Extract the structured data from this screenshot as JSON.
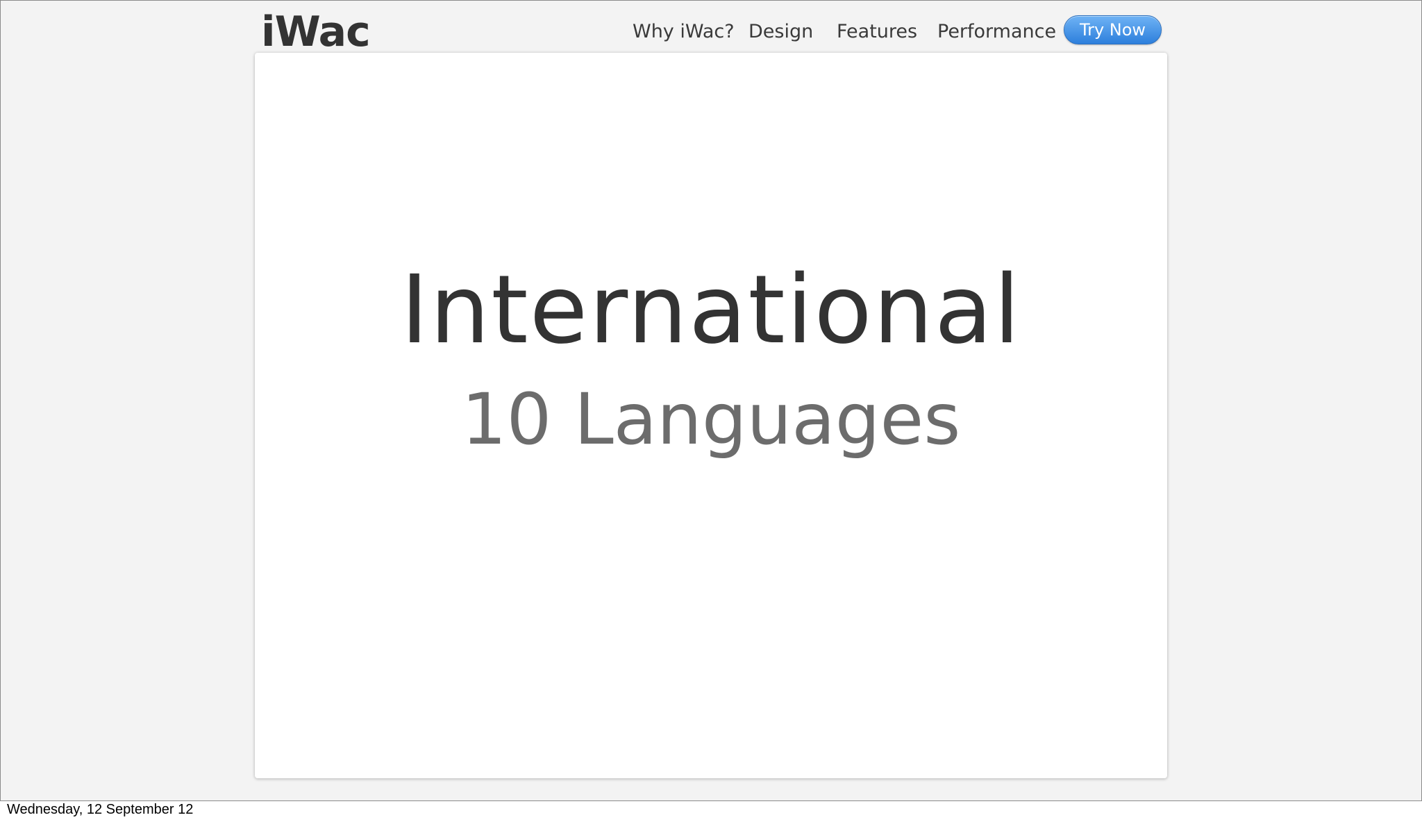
{
  "header": {
    "brand": "iWac",
    "nav": [
      {
        "label": "Why iWac?"
      },
      {
        "label": "Design"
      },
      {
        "label": "Features"
      },
      {
        "label": "Performance"
      }
    ],
    "cta_label": "Try Now"
  },
  "main": {
    "headline": "International",
    "subheadline": "10 Languages"
  },
  "footer": {
    "date": "Wednesday, 12 September 12"
  },
  "colors": {
    "background": "#f3f3f3",
    "card": "#ffffff",
    "text_primary": "#333333",
    "text_secondary": "#6c6c6c",
    "button_accent": "#3a8ee6"
  }
}
